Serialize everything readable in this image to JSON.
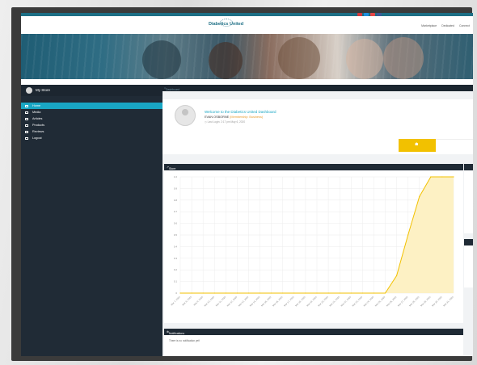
{
  "header": {
    "logo": "Diabetics United",
    "nav": [
      "Marketplace",
      "Dedicated",
      "Connect"
    ],
    "social_colors": [
      "#d9383a",
      "#1d8fe0",
      "#e84545",
      "#3b5998"
    ]
  },
  "sidebar": {
    "store_title": "My Store",
    "items": [
      {
        "label": "Home",
        "icon": "monitor-icon",
        "active": true
      },
      {
        "label": "Media",
        "icon": "media-icon",
        "active": false
      },
      {
        "label": "Articles",
        "icon": "articles-icon",
        "active": false
      },
      {
        "label": "Products",
        "icon": "products-icon",
        "active": false
      },
      {
        "label": "Reviews",
        "icon": "reviews-icon",
        "active": false
      },
      {
        "label": "Logout",
        "icon": "logout-icon",
        "active": false
      }
    ]
  },
  "breadcrumb": "Dashboard",
  "welcome": {
    "title": "Welcome to the Diabetics United Dashboard",
    "name": "EVAN OSBORNE",
    "badge": "(Membership: Business)",
    "last_login": "Last Login: 2:17 pm May 6, 2020"
  },
  "analytics": {
    "title": "Store Analytics",
    "chart_data": {
      "type": "area",
      "x": [
        "Mar 7, 2020",
        "Mar 8, 2020",
        "Mar 9, 2020",
        "Mar 10, 2020",
        "Mar 11, 2020",
        "Mar 12, 2020",
        "Mar 13, 2020",
        "Mar 14, 2020",
        "Mar 15, 2020",
        "Mar 16, 2020",
        "Mar 17, 2020",
        "Mar 18, 2020",
        "Mar 19, 2020",
        "Mar 20, 2020",
        "Mar 21, 2020",
        "Mar 22, 2020",
        "Mar 23, 2020",
        "Mar 24, 2020",
        "Mar 25, 2020",
        "Mar 26, 2020",
        "Mar 27, 2020",
        "Mar 28, 2020",
        "Mar 29, 2020",
        "Mar 30, 2020",
        "Mar 31, 2020"
      ],
      "yticks": [
        "1.0",
        "0.9",
        "0.8",
        "0.7",
        "0.6",
        "0.5",
        "0.4",
        "0.3",
        "0.2",
        "0.1",
        "0"
      ],
      "series": [
        {
          "values": [
            0,
            0,
            0,
            0,
            0,
            0,
            0,
            0,
            0,
            0,
            0,
            0,
            0,
            0,
            0,
            0,
            0,
            0,
            0,
            0.15,
            0.5,
            0.83,
            1,
            1,
            1
          ]
        }
      ],
      "ylim": [
        0,
        1.0
      ],
      "color": "#f2c100",
      "fill": "#fdf1c4"
    }
  },
  "notifications": {
    "title": "Notifications",
    "empty_text": "There is no notification yet!"
  }
}
